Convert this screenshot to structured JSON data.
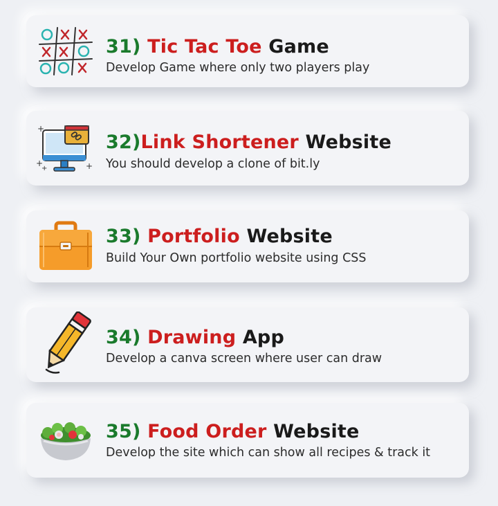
{
  "items": [
    {
      "number": "31)",
      "highlight": "Tic Tac Toe",
      "rest": " Game",
      "description": "Develop Game where only two  players play",
      "icon": "tic-tac-toe-icon"
    },
    {
      "number": "32)",
      "highlight": "Link Shortener",
      "rest": " Website",
      "description": "You should develop a clone of bit.ly",
      "icon": "monitor-link-icon"
    },
    {
      "number": "33)",
      "highlight": "Portfolio",
      "rest": " Website",
      "description": "Build Your Own portfolio website using CSS",
      "icon": "briefcase-icon"
    },
    {
      "number": "34)",
      "highlight": "Drawing",
      "rest": " App",
      "description": "Develop a canva screen where user can draw",
      "icon": "pencil-icon"
    },
    {
      "number": "35)",
      "highlight": "Food Order",
      "rest": " Website",
      "description": "Develop the site which can show all recipes & track it",
      "icon": "salad-bowl-icon"
    }
  ],
  "colors": {
    "number": "#1a7a2c",
    "highlight": "#cc1e1e",
    "text": "#1a1a1a",
    "background": "#eef0f4"
  }
}
